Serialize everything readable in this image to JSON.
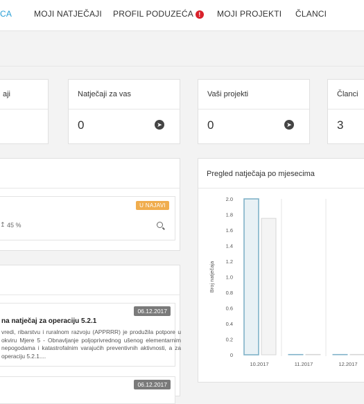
{
  "nav": {
    "items": [
      {
        "label": "CA",
        "active": true
      },
      {
        "label": "MOJI NATJEČAJI",
        "active": false
      },
      {
        "label": "PROFIL PODUZEĆA",
        "active": false,
        "alert": "!"
      },
      {
        "label": "MOJI PROJEKTI",
        "active": false
      },
      {
        "label": "ČLANCI",
        "active": false
      }
    ]
  },
  "cards": [
    {
      "title": "aji",
      "value": ""
    },
    {
      "title": "Natječaji za vas",
      "value": "0",
      "icon": "arrow-circle-right-icon"
    },
    {
      "title": "Vaši projekti",
      "value": "0",
      "icon": "arrow-circle-right-icon"
    },
    {
      "title": "Članci",
      "value": "3"
    }
  ],
  "tender_panel": {
    "badge": "U NAJAVI",
    "progress_text": "45 %",
    "progress_value": 45
  },
  "news": [
    {
      "date": "06.12.2017",
      "title": "na natječaj za operaciju 5.2.1",
      "body": "vredi, ribarstvu i ruralnom razvoju (APPRRR) je produžila potpore u okviru Mjere 5 - Obnavljanje poljoprivrednog ušenog elementarnim nepogodama i katastrofalnim varajućih preventivnih aktivnosti, a za operaciju 5.2.1...."
    },
    {
      "date": "06.12.2017"
    }
  ],
  "chart_panel": {
    "title": "Pregled natječaja po mjesecima"
  },
  "chart_data": {
    "type": "bar",
    "title": "",
    "ylabel": "Broj natječaja",
    "xlabel": "",
    "ylim": [
      0,
      2.0
    ],
    "yticks": [
      "2.0",
      "1.8",
      "1.6",
      "1.4",
      "1.2",
      "1.0",
      "0.8",
      "0.6",
      "0.4",
      "0.2",
      "0"
    ],
    "categories": [
      "10.2017",
      "11.2017",
      "12.2017"
    ],
    "series": [
      {
        "values": [
          2.0,
          0,
          0
        ],
        "color": "#e8f1f5",
        "stroke": "#7fb2c8"
      },
      {
        "values": [
          1.75,
          0,
          0
        ],
        "color": "#f4f4f4",
        "stroke": "#d6d6d6"
      }
    ]
  }
}
